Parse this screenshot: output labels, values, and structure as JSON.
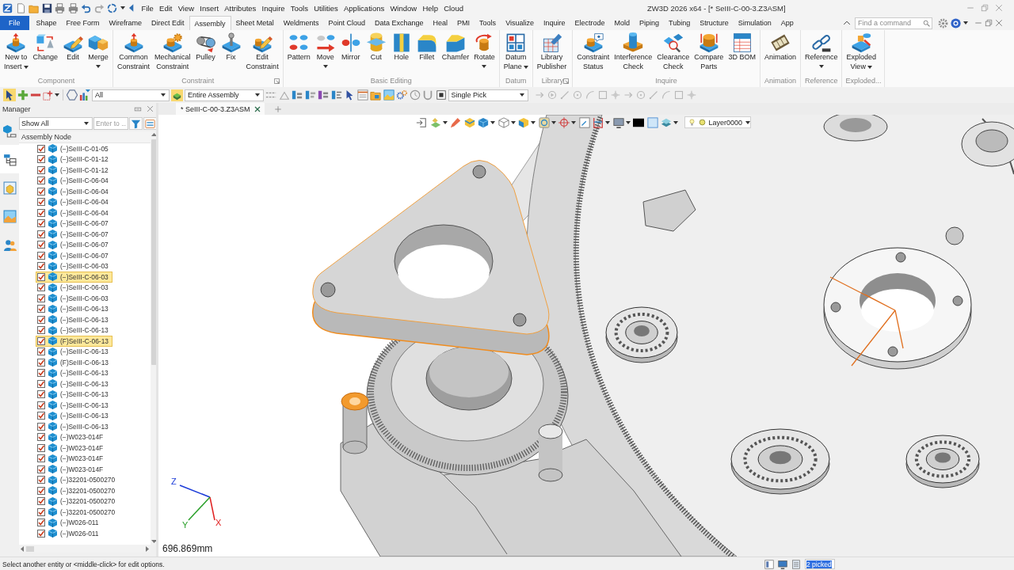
{
  "window": {
    "title": "ZW3D 2026 x64 - [* SeIII-C-00-3.Z3ASM]"
  },
  "menu": [
    "File",
    "Edit",
    "View",
    "Insert",
    "Attributes",
    "Inquire",
    "Tools",
    "Utilities",
    "Applications",
    "Window",
    "Help",
    "Cloud"
  ],
  "ribbon_tabs": [
    {
      "label": "File",
      "kind": "backstage",
      "selected": false
    },
    {
      "label": "Shape",
      "kind": "tab",
      "selected": false
    },
    {
      "label": "Free Form",
      "kind": "tab",
      "selected": false
    },
    {
      "label": "Wireframe",
      "kind": "tab",
      "selected": false
    },
    {
      "label": "Direct Edit",
      "kind": "tab",
      "selected": false
    },
    {
      "label": "Assembly",
      "kind": "tab",
      "selected": true
    },
    {
      "label": "Sheet Metal",
      "kind": "tab",
      "selected": false
    },
    {
      "label": "Weldments",
      "kind": "tab",
      "selected": false
    },
    {
      "label": "Point Cloud",
      "kind": "tab",
      "selected": false
    },
    {
      "label": "Data Exchange",
      "kind": "tab",
      "selected": false
    },
    {
      "label": "Heal",
      "kind": "tab",
      "selected": false
    },
    {
      "label": "PMI",
      "kind": "tab",
      "selected": false
    },
    {
      "label": "Tools",
      "kind": "tab",
      "selected": false
    },
    {
      "label": "Visualize",
      "kind": "tab",
      "selected": false
    },
    {
      "label": "Inquire",
      "kind": "tab",
      "selected": false
    },
    {
      "label": "Electrode",
      "kind": "tab",
      "selected": false
    },
    {
      "label": "Mold",
      "kind": "tab",
      "selected": false
    },
    {
      "label": "Piping",
      "kind": "tab",
      "selected": false
    },
    {
      "label": "Tubing",
      "kind": "tab",
      "selected": false
    },
    {
      "label": "Structure",
      "kind": "tab",
      "selected": false
    },
    {
      "label": "Simulation",
      "kind": "tab",
      "selected": false
    },
    {
      "label": "App",
      "kind": "tab",
      "selected": false
    }
  ],
  "command_search": {
    "placeholder": "Find a command"
  },
  "ribbon_groups": [
    {
      "title": "Component",
      "launcher": false,
      "commands": [
        {
          "label": "New to\nInsert",
          "dropdown": true
        },
        {
          "label": "Change",
          "dropdown": false
        },
        {
          "label": "Edit",
          "dropdown": false
        },
        {
          "label": "Merge",
          "dropdown": true
        }
      ]
    },
    {
      "title": "Constraint",
      "launcher": true,
      "commands": [
        {
          "label": "Common\nConstraint",
          "dropdown": false
        },
        {
          "label": "Mechanical\nConstraint",
          "dropdown": false
        },
        {
          "label": "Pulley",
          "dropdown": false
        },
        {
          "label": "Fix",
          "dropdown": false
        },
        {
          "label": "Edit\nConstraint",
          "dropdown": false
        }
      ]
    },
    {
      "title": "Basic Editing",
      "launcher": false,
      "commands": [
        {
          "label": "Pattern",
          "dropdown": false
        },
        {
          "label": "Move",
          "dropdown": true
        },
        {
          "label": "Mirror",
          "dropdown": false
        },
        {
          "label": "Cut",
          "dropdown": false
        },
        {
          "label": "Hole",
          "dropdown": false
        },
        {
          "label": "Fillet",
          "dropdown": false
        },
        {
          "label": "Chamfer",
          "dropdown": false
        },
        {
          "label": "Rotate",
          "dropdown": true
        }
      ]
    },
    {
      "title": "Datum",
      "launcher": false,
      "commands": [
        {
          "label": "Datum\nPlane",
          "dropdown": true
        }
      ]
    },
    {
      "title": "Library",
      "launcher": true,
      "commands": [
        {
          "label": "Library\nPublisher",
          "dropdown": false
        }
      ]
    },
    {
      "title": "Inquire",
      "launcher": false,
      "commands": [
        {
          "label": "Constraint\nStatus",
          "dropdown": false
        },
        {
          "label": "Interference\nCheck",
          "dropdown": false
        },
        {
          "label": "Clearance\nCheck",
          "dropdown": false
        },
        {
          "label": "Compare\nParts",
          "dropdown": false
        },
        {
          "label": "3D BOM",
          "dropdown": false
        }
      ]
    },
    {
      "title": "Animation",
      "launcher": false,
      "commands": [
        {
          "label": "Animation",
          "dropdown": false
        }
      ]
    },
    {
      "title": "Reference",
      "launcher": false,
      "commands": [
        {
          "label": "Reference",
          "dropdown": true
        }
      ]
    },
    {
      "title": "Exploded...",
      "launcher": false,
      "commands": [
        {
          "label": "Exploded\nView",
          "dropdown": true
        }
      ]
    }
  ],
  "toolbar": {
    "pick_filter": "All",
    "scope": "Entire Assembly",
    "pick_mode": "Single Pick"
  },
  "manager": {
    "title": "Manager",
    "side_tabs": [
      {
        "selected": false
      },
      {
        "selected": true
      },
      {
        "selected": false
      },
      {
        "selected": false
      },
      {
        "selected": false
      }
    ],
    "filter": "Show All",
    "search": {
      "placeholder": "Enter to ..."
    },
    "tree_header": "Assembly Node",
    "nodes": [
      {
        "label": "(−)SeIII-C-01-05",
        "checked": true,
        "selected": false
      },
      {
        "label": "(−)SeIII-C-01-12",
        "checked": true,
        "selected": false
      },
      {
        "label": "(−)SeIII-C-01-12",
        "checked": true,
        "selected": false
      },
      {
        "label": "(−)SeIII-C-06-04",
        "checked": true,
        "selected": false
      },
      {
        "label": "(−)SeIII-C-06-04",
        "checked": true,
        "selected": false
      },
      {
        "label": "(−)SeIII-C-06-04",
        "checked": true,
        "selected": false
      },
      {
        "label": "(−)SeIII-C-06-04",
        "checked": true,
        "selected": false
      },
      {
        "label": "(−)SeIII-C-06-07",
        "checked": true,
        "selected": false
      },
      {
        "label": "(−)SeIII-C-06-07",
        "checked": true,
        "selected": false
      },
      {
        "label": "(−)SeIII-C-06-07",
        "checked": true,
        "selected": false
      },
      {
        "label": "(−)SeIII-C-06-07",
        "checked": true,
        "selected": false
      },
      {
        "label": "(−)SeIII-C-06-03",
        "checked": true,
        "selected": false
      },
      {
        "label": "(−)SeIII-C-06-03",
        "checked": true,
        "selected": true
      },
      {
        "label": "(−)SeIII-C-06-03",
        "checked": true,
        "selected": false
      },
      {
        "label": "(−)SeIII-C-06-03",
        "checked": true,
        "selected": false
      },
      {
        "label": "(−)SeIII-C-06-13",
        "checked": true,
        "selected": false
      },
      {
        "label": "(−)SeIII-C-06-13",
        "checked": true,
        "selected": false
      },
      {
        "label": "(−)SeIII-C-06-13",
        "checked": true,
        "selected": false
      },
      {
        "label": "(F)SeIII-C-06-13",
        "checked": true,
        "selected": true
      },
      {
        "label": "(−)SeIII-C-06-13",
        "checked": true,
        "selected": false
      },
      {
        "label": "(F)SeIII-C-06-13",
        "checked": true,
        "selected": false
      },
      {
        "label": "(−)SeIII-C-06-13",
        "checked": true,
        "selected": false
      },
      {
        "label": "(−)SeIII-C-06-13",
        "checked": true,
        "selected": false
      },
      {
        "label": "(−)SeIII-C-06-13",
        "checked": true,
        "selected": false
      },
      {
        "label": "(−)SeIII-C-06-13",
        "checked": true,
        "selected": false
      },
      {
        "label": "(−)SeIII-C-06-13",
        "checked": true,
        "selected": false
      },
      {
        "label": "(−)SeIII-C-06-13",
        "checked": true,
        "selected": false
      },
      {
        "label": "(−)W023-014F",
        "checked": true,
        "selected": false
      },
      {
        "label": "(−)W023-014F",
        "checked": true,
        "selected": false
      },
      {
        "label": "(−)W023-014F",
        "checked": true,
        "selected": false
      },
      {
        "label": "(−)W023-014F",
        "checked": true,
        "selected": false
      },
      {
        "label": "(−)32201-0500270",
        "checked": true,
        "selected": false
      },
      {
        "label": "(−)32201-0500270",
        "checked": true,
        "selected": false
      },
      {
        "label": "(−)32201-0500270",
        "checked": true,
        "selected": false
      },
      {
        "label": "(−)32201-0500270",
        "checked": true,
        "selected": false
      },
      {
        "label": "(−)W026-011",
        "checked": true,
        "selected": false
      },
      {
        "label": "(−)W026-011",
        "checked": true,
        "selected": false
      }
    ]
  },
  "document_tabs": [
    {
      "label": "* SeIII-C-00-3.Z3ASM",
      "selected": true
    }
  ],
  "viewport": {
    "layer": "Layer0000",
    "axes": [
      "Z",
      "Y",
      "X"
    ],
    "scale_reading": "696.869mm"
  },
  "status_bar": {
    "prompt": "Select another entity or <middle-click> for edit options.",
    "picked": "2 picked"
  }
}
